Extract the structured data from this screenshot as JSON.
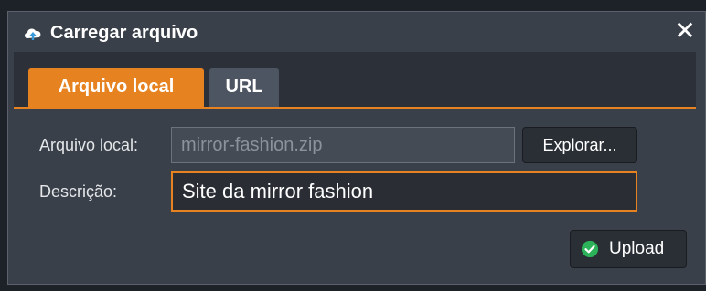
{
  "dialog": {
    "title": "Carregar arquivo",
    "close_glyph": "✕",
    "title_icon": "cloud-upload-icon",
    "close_icon": "close-icon"
  },
  "tabs": [
    {
      "label": "Arquivo local",
      "active": true
    },
    {
      "label": "URL",
      "active": false
    }
  ],
  "form": {
    "file_label": "Arquivo local:",
    "file_value": "mirror-fashion.zip",
    "browse_label": "Explorar...",
    "description_label": "Descrição:",
    "description_value": "Site da mirror fashion"
  },
  "footer": {
    "upload_label": "Upload",
    "upload_icon": "check-circle-icon"
  },
  "colors": {
    "accent": "#e6821f",
    "dialog_bg": "#3a4049",
    "success": "#2cb35a"
  }
}
